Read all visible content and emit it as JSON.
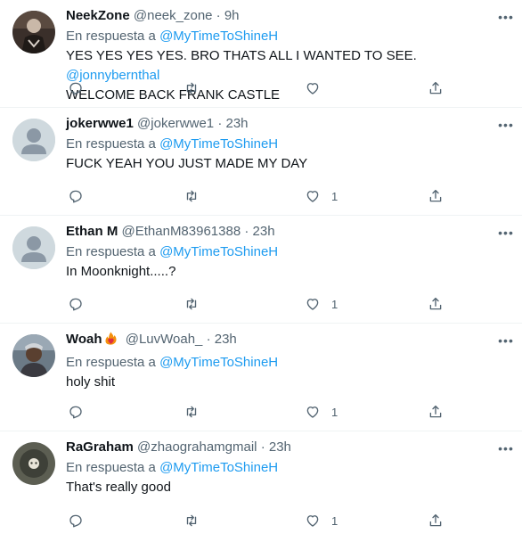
{
  "reply_prefix": "En respuesta a",
  "mention_handle": "@MyTimeToShineH",
  "dot": "·",
  "more_label": "•••",
  "tweets": [
    {
      "name": "NeekZone",
      "handle": "@neek_zone",
      "time": "9h",
      "text": "YES YES YES YES. BRO THATS ALL I WANTED TO SEE.",
      "text_mention": "@jonnybernthal",
      "text_line2": "WELCOME BACK FRANK CASTLE",
      "likes": ""
    },
    {
      "name": "jokerwwe1",
      "handle": "@jokerwwe1",
      "time": "23h",
      "text": "FUCK YEAH YOU JUST MADE MY DAY",
      "likes": "1"
    },
    {
      "name": "Ethan M",
      "handle": "@EthanM83961388",
      "time": "23h",
      "text": "In Moonknight.....?",
      "likes": "1"
    },
    {
      "name": "Woah",
      "handle": "@LuvWoah_",
      "time": "23h",
      "text": "holy shit",
      "likes": "1"
    },
    {
      "name": "RaGraham",
      "handle": "@zhaograhamgmail",
      "time": "23h",
      "text": "That's really good",
      "likes": "1"
    }
  ]
}
